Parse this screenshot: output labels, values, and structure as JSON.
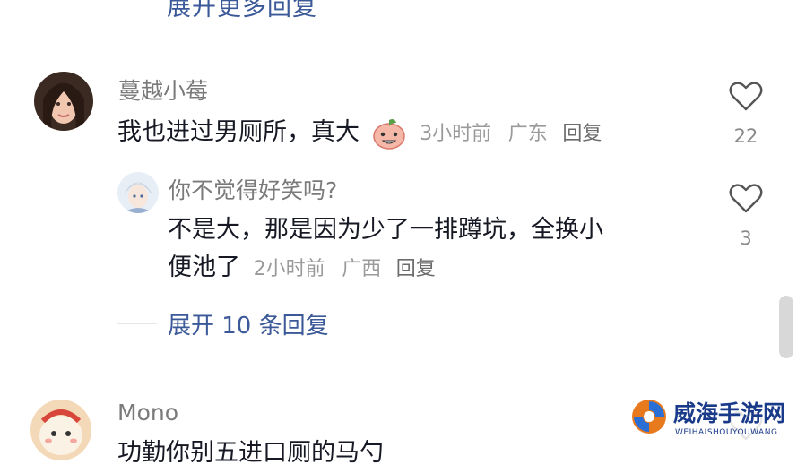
{
  "top_expand_label": "展开更多回复",
  "comments": [
    {
      "name": "蔓越小莓",
      "text": "我也进过男厕所，真大",
      "time": "3小时前",
      "location": "广东",
      "reply_label": "回复",
      "likes": "22"
    }
  ],
  "reply": {
    "name": "你不觉得好笑吗?",
    "text_line1": "不是大，那是因为少了一排蹲坑，全换小",
    "text_line2": "便池了",
    "time": "2小时前",
    "location": "广西",
    "reply_label": "回复",
    "likes": "3"
  },
  "expand_replies_label": "展开 10 条回复",
  "next_comment": {
    "name": "Mono",
    "text_partial": "功勤你别五进口厕的马勺"
  },
  "watermark": {
    "title": "威海手游网",
    "subtitle": "WEIHAISHOUYOUWANG"
  },
  "colors": {
    "link": "#3b5998",
    "meta": "#9a9a9a",
    "text": "#161823"
  }
}
